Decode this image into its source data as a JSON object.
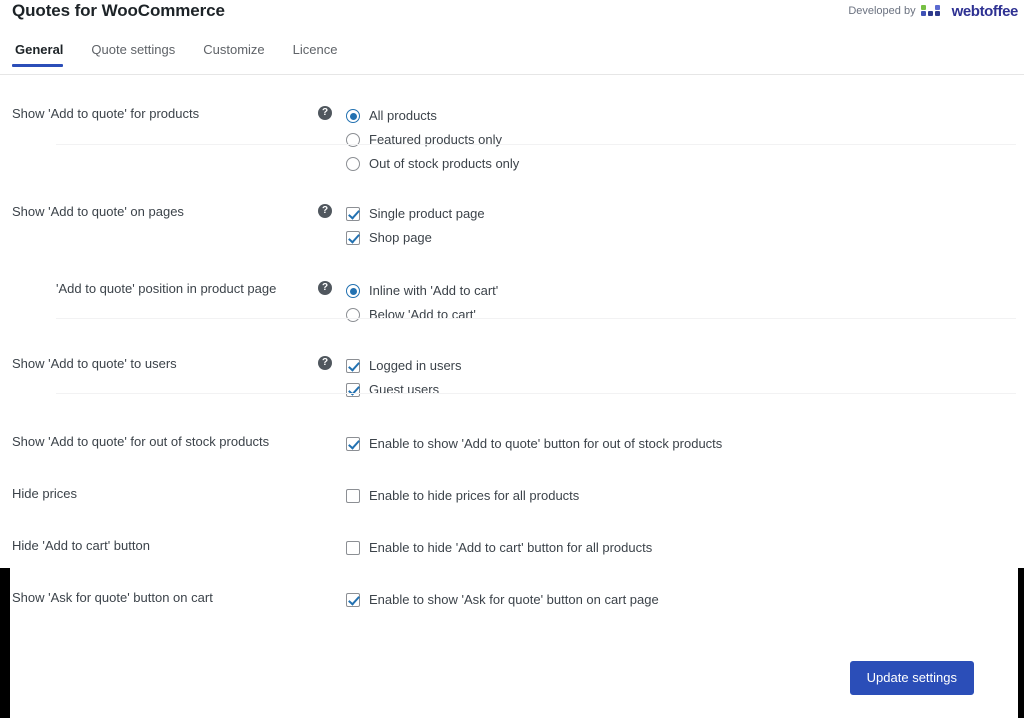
{
  "header": {
    "title": "Quotes for WooCommerce",
    "developed_by_label": "Developed by",
    "brand_name": "webtoffee",
    "brand_colors": {
      "green": "#76c043",
      "blue": "#3f51b5",
      "dark_blue": "#2e3192"
    }
  },
  "tabs": [
    {
      "label": "General",
      "active": true
    },
    {
      "label": "Quote settings",
      "active": false
    },
    {
      "label": "Customize",
      "active": false
    },
    {
      "label": "Licence",
      "active": false
    }
  ],
  "help_icon_glyph": "?",
  "settings": [
    {
      "label": "Show 'Add to quote' for products",
      "has_help": true,
      "indent": false,
      "control": "radio",
      "options": [
        {
          "label": "All products",
          "checked": true
        },
        {
          "label": "Featured products only",
          "checked": false
        },
        {
          "label": "Out of stock products only",
          "checked": false
        }
      ]
    },
    {
      "label": "Show 'Add to quote' on pages",
      "has_help": true,
      "indent": false,
      "control": "checkbox",
      "options": [
        {
          "label": "Single product page",
          "checked": true
        },
        {
          "label": "Shop page",
          "checked": true
        }
      ]
    },
    {
      "label": "'Add to quote' position in product page",
      "has_help": true,
      "indent": true,
      "control": "radio",
      "options": [
        {
          "label": "Inline with 'Add to cart'",
          "checked": true
        },
        {
          "label": "Below 'Add to cart'",
          "checked": false
        }
      ]
    },
    {
      "label": "Show 'Add to quote' to users",
      "has_help": true,
      "indent": false,
      "control": "checkbox",
      "options": [
        {
          "label": "Logged in users",
          "checked": true
        },
        {
          "label": "Guest users",
          "checked": true
        }
      ]
    },
    {
      "label": "Show 'Add to quote' for out of stock products",
      "has_help": false,
      "indent": false,
      "control": "checkbox",
      "options": [
        {
          "label": "Enable to show 'Add to quote' button for out of stock products",
          "checked": true
        }
      ]
    },
    {
      "label": "Hide prices",
      "has_help": false,
      "indent": false,
      "control": "checkbox",
      "options": [
        {
          "label": "Enable to hide prices for all products",
          "checked": false
        }
      ]
    },
    {
      "label": "Hide 'Add to cart' button",
      "has_help": false,
      "indent": false,
      "control": "checkbox",
      "options": [
        {
          "label": "Enable to hide 'Add to cart' button for all products",
          "checked": false
        }
      ]
    },
    {
      "label": "Show 'Ask for quote' button on cart",
      "has_help": false,
      "indent": false,
      "control": "checkbox",
      "options": [
        {
          "label": "Enable to show 'Ask for quote' button on cart page",
          "checked": true
        }
      ]
    }
  ],
  "footer": {
    "submit_label": "Update settings",
    "submit_color": "#2b4eb8"
  }
}
